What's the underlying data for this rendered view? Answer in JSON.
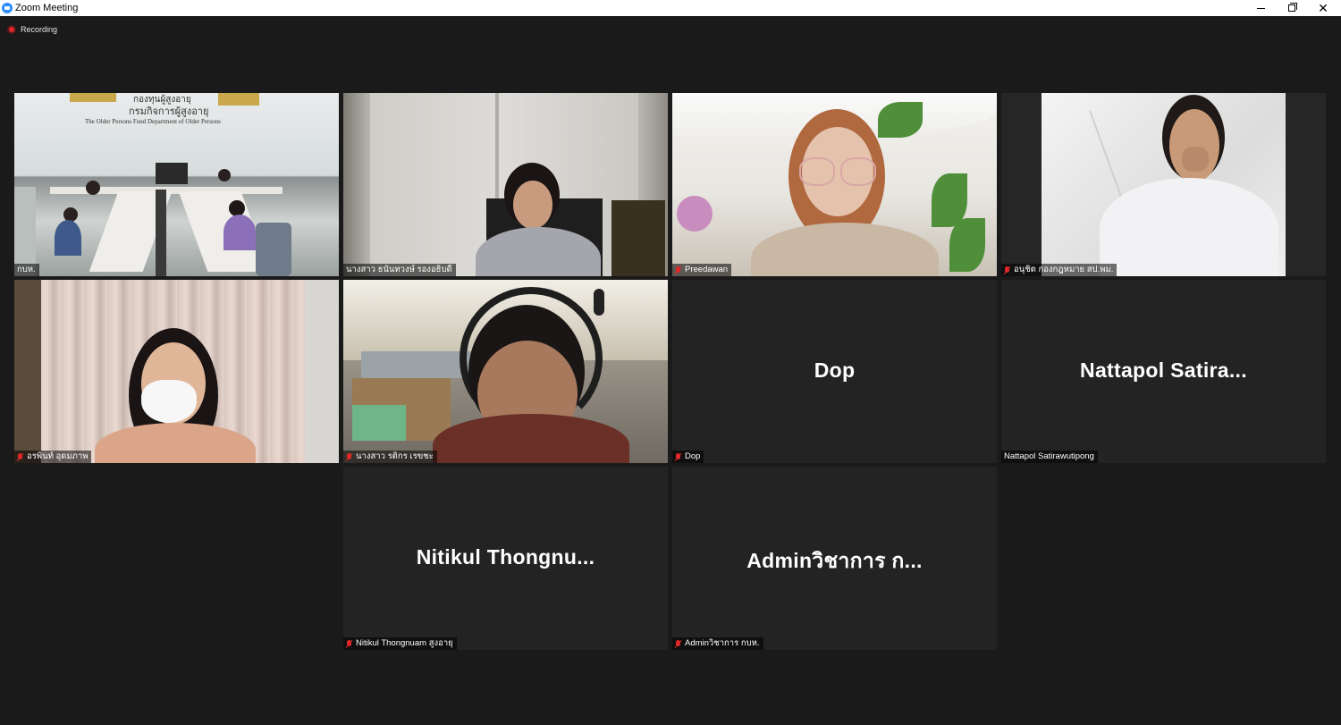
{
  "window": {
    "title": "Zoom Meeting",
    "minimize_icon": "minimize-icon",
    "maximize_icon": "restore-icon",
    "close_icon": "close-icon"
  },
  "recording": {
    "label": "Recording",
    "color": "#e02828"
  },
  "colors": {
    "active_speaker_border": "#9ecf2e",
    "tile_background": "#232323",
    "muted_icon": "#e02828"
  },
  "tiles": [
    {
      "id": "room",
      "name": "กบห.",
      "muted": false,
      "video": true,
      "active": true,
      "sign": {
        "line1": "กองทุนผู้สูงอายุ",
        "line2": "กรมกิจการผู้สูงอายุ",
        "line3": "The Older Persons Fund     Department of Older Persons"
      }
    },
    {
      "id": "p2",
      "name": "นางสาว ธนันทวงษ์ รองอธิบดี",
      "muted": false,
      "video": true,
      "active": false
    },
    {
      "id": "p3",
      "name": "Preedawan",
      "muted": true,
      "video": true,
      "active": false
    },
    {
      "id": "p4",
      "name": "อนุชิต กองกฎหมาย สป.พม.",
      "muted": true,
      "video": true,
      "active": false
    },
    {
      "id": "p5",
      "name": "อรพินท์ อุดมภาพ",
      "muted": true,
      "video": true,
      "active": false
    },
    {
      "id": "p6",
      "name": "นางสาว รติกร เรขชะ",
      "muted": true,
      "video": true,
      "active": false
    },
    {
      "id": "p7",
      "name": "Dop",
      "display_name": "Dop",
      "muted": true,
      "video": false,
      "active": false
    },
    {
      "id": "p8",
      "name": "Nattapol Satirawutipong",
      "display_name": "Nattapol Satira...",
      "muted": false,
      "video": false,
      "active": false
    },
    {
      "id": "p9",
      "name": "Nitikul Thongnuam สูงอายุ",
      "display_name": "Nitikul Thongnu...",
      "muted": true,
      "video": false,
      "active": false
    },
    {
      "id": "p10",
      "name": "Adminวิชาการ กบห.",
      "display_name": "Adminวิชาการ ก...",
      "muted": true,
      "video": false,
      "active": false
    }
  ]
}
